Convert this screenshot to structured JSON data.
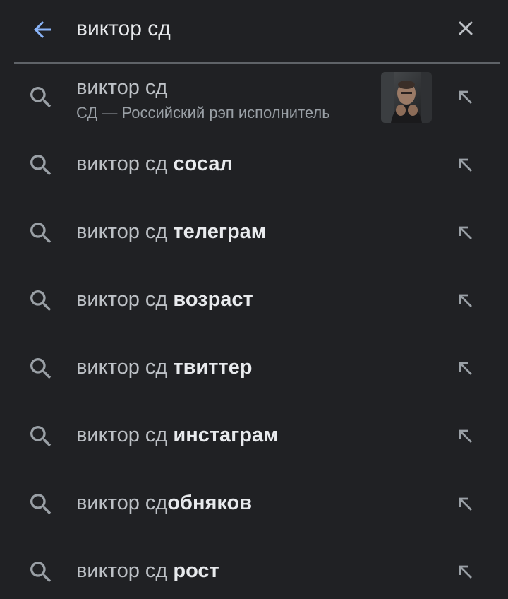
{
  "search": {
    "query": "виктор сд",
    "back_icon": "arrow-left-icon",
    "clear_icon": "close-icon",
    "accent": "#8ab4f8"
  },
  "suggestions": [
    {
      "prefix": "виктор сд",
      "suffix": "",
      "subtitle": "СД — Российский рэп исполнитель",
      "has_thumbnail": true
    },
    {
      "prefix": "виктор сд ",
      "suffix": "сосал"
    },
    {
      "prefix": "виктор сд ",
      "suffix": "телеграм"
    },
    {
      "prefix": "виктор сд ",
      "suffix": "возраст"
    },
    {
      "prefix": "виктор сд ",
      "suffix": "твиттер"
    },
    {
      "prefix": "виктор сд ",
      "suffix": "инстаграм"
    },
    {
      "prefix": "виктор сд",
      "suffix": "обняков"
    },
    {
      "prefix": "виктор сд ",
      "suffix": "рост"
    }
  ]
}
